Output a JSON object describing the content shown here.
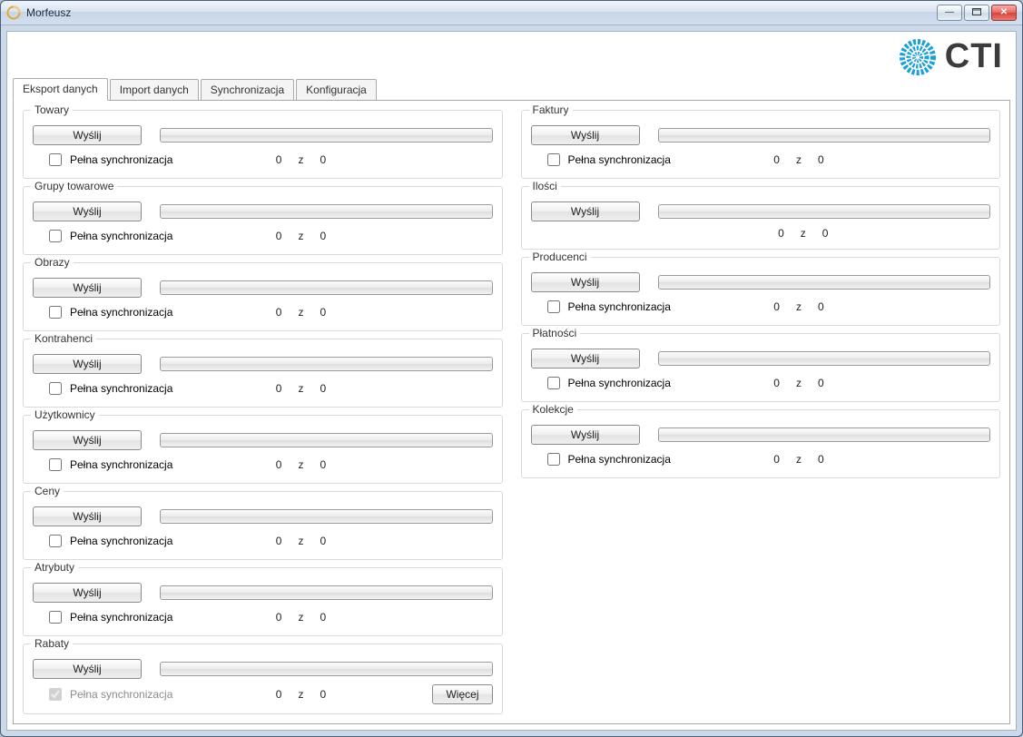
{
  "window": {
    "title": "Morfeusz"
  },
  "logo": {
    "text": "CTI"
  },
  "tabs": [
    {
      "label": "Eksport danych",
      "active": true
    },
    {
      "label": "Import danych",
      "active": false
    },
    {
      "label": "Synchronizacja",
      "active": false
    },
    {
      "label": "Konfiguracja",
      "active": false
    }
  ],
  "common": {
    "send_label": "Wyślij",
    "full_sync_label": "Pełna synchronizacja",
    "of_label": "z",
    "more_label": "Więcej"
  },
  "left": [
    {
      "title": "Towary",
      "done": "0",
      "total": "0",
      "full_sync_checked": false,
      "full_sync_enabled": true,
      "more": false
    },
    {
      "title": "Grupy towarowe",
      "done": "0",
      "total": "0",
      "full_sync_checked": false,
      "full_sync_enabled": true,
      "more": false
    },
    {
      "title": "Obrazy",
      "done": "0",
      "total": "0",
      "full_sync_checked": false,
      "full_sync_enabled": true,
      "more": false
    },
    {
      "title": "Kontrahenci",
      "done": "0",
      "total": "0",
      "full_sync_checked": false,
      "full_sync_enabled": true,
      "more": false
    },
    {
      "title": "Użytkownicy",
      "done": "0",
      "total": "0",
      "full_sync_checked": false,
      "full_sync_enabled": true,
      "more": false
    },
    {
      "title": "Ceny",
      "done": "0",
      "total": "0",
      "full_sync_checked": false,
      "full_sync_enabled": true,
      "more": false
    },
    {
      "title": "Atrybuty",
      "done": "0",
      "total": "0",
      "full_sync_checked": false,
      "full_sync_enabled": true,
      "more": false
    },
    {
      "title": "Rabaty",
      "done": "0",
      "total": "0",
      "full_sync_checked": true,
      "full_sync_enabled": false,
      "more": true
    }
  ],
  "right": [
    {
      "title": "Faktury",
      "done": "0",
      "total": "0",
      "has_full_sync": true,
      "full_sync_checked": false
    },
    {
      "title": "Ilości",
      "done": "0",
      "total": "0",
      "has_full_sync": false,
      "full_sync_checked": false
    },
    {
      "title": "Producenci",
      "done": "0",
      "total": "0",
      "has_full_sync": true,
      "full_sync_checked": false
    },
    {
      "title": "Płatności",
      "done": "0",
      "total": "0",
      "has_full_sync": true,
      "full_sync_checked": false
    },
    {
      "title": "Kolekcje",
      "done": "0",
      "total": "0",
      "has_full_sync": true,
      "full_sync_checked": false
    }
  ]
}
